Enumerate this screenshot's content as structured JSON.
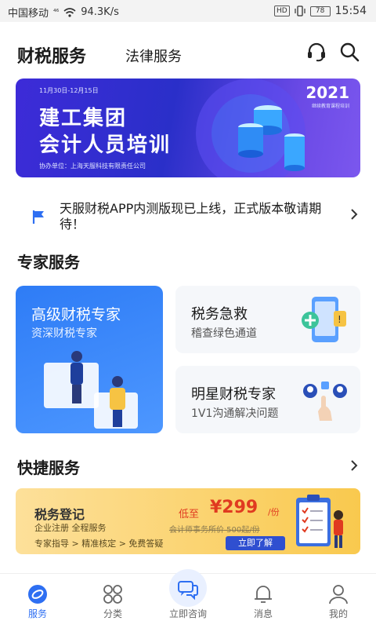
{
  "status_bar": {
    "carrier": "中国移动",
    "network": "⁴⁶",
    "speed": "94.3K/s",
    "hd": "HD",
    "battery": "78",
    "time": "15:54"
  },
  "header": {
    "tab_active": "财税服务",
    "tab_other": "法律服务",
    "icons": [
      "headset-icon",
      "search-icon"
    ]
  },
  "banner": {
    "date": "11月30日-12月15日",
    "line1": "建工集团",
    "line2": "会计人员培训",
    "company": "协办单位：上海天服科技有限责任公司",
    "year": "2021",
    "year_sub": "继续教育课程培训"
  },
  "notice": {
    "text": "天服财税APP内测版现已上线，正式版本敬请期待！"
  },
  "expert": {
    "title": "专家服务",
    "big_card": {
      "title": "高级财税专家",
      "subtitle": "资深财税专家"
    },
    "cards": [
      {
        "title": "税务急救",
        "subtitle": "稽查绿色通道"
      },
      {
        "title": "明星财税专家",
        "subtitle": "1V1沟通解决问题"
      }
    ]
  },
  "quick": {
    "title": "快捷服务",
    "card": {
      "title": "税务登记",
      "subtitle": "企业注册 全程服务",
      "steps": "专家指导 > 精准核定 > 免费答疑",
      "price_prefix": "低至",
      "price": "¥299",
      "price_unit": "/份",
      "orig_price": "会计师事务所价 500起/份",
      "button": "立即了解"
    }
  },
  "bottom_nav": {
    "items": [
      {
        "label": "服务",
        "icon": "service-icon",
        "active": true
      },
      {
        "label": "分类",
        "icon": "category-icon",
        "active": false
      },
      {
        "label": "立即咨询",
        "icon": "chat-icon",
        "active": false
      },
      {
        "label": "消息",
        "icon": "bell-icon",
        "active": false
      },
      {
        "label": "我的",
        "icon": "user-icon",
        "active": false
      }
    ]
  },
  "colors": {
    "primary": "#2e6ff2",
    "banner_bg": "#3d2bd8",
    "quick_card_bg": "#f9c94e",
    "price": "#e03a20"
  }
}
